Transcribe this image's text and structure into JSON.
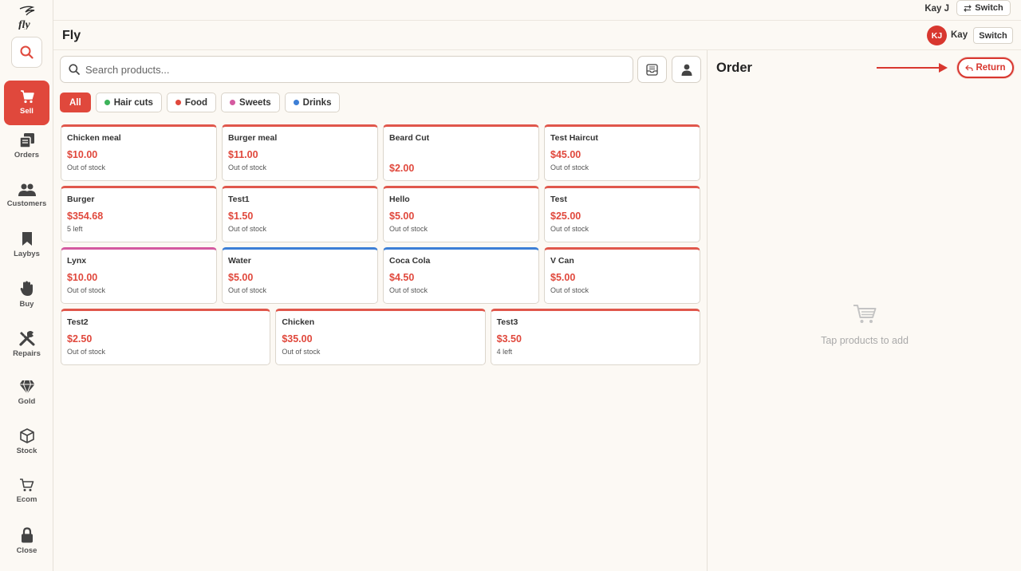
{
  "app": {
    "logo_text": "fly",
    "title": "Fly"
  },
  "topbar": {
    "user": "Kay J",
    "switch_label": "Switch"
  },
  "header": {
    "avatar_initials": "KJ",
    "user": "Kay",
    "switch_label": "Switch"
  },
  "sidebar": {
    "items": [
      {
        "label": "Sell",
        "icon": "cart-icon",
        "active": true
      },
      {
        "label": "Orders",
        "icon": "orders-icon"
      },
      {
        "label": "Customers",
        "icon": "customers-icon"
      },
      {
        "label": "Laybys",
        "icon": "bookmark-icon"
      },
      {
        "label": "Buy",
        "icon": "hand-icon"
      },
      {
        "label": "Repairs",
        "icon": "tools-icon"
      },
      {
        "label": "Gold",
        "icon": "diamond-icon"
      },
      {
        "label": "Stock",
        "icon": "box-icon"
      },
      {
        "label": "Ecom",
        "icon": "ecom-cart-icon"
      },
      {
        "label": "Close",
        "icon": "lock-icon"
      }
    ]
  },
  "search": {
    "placeholder": "Search products..."
  },
  "categories": [
    {
      "label": "All",
      "active": true
    },
    {
      "label": "Hair cuts",
      "color": "#3cb35a"
    },
    {
      "label": "Food",
      "color": "#e0483c"
    },
    {
      "label": "Sweets",
      "color": "#d45aa0"
    },
    {
      "label": "Drinks",
      "color": "#3d7fd6"
    }
  ],
  "products": [
    {
      "name": "Chicken meal",
      "price": "$10.00",
      "stock": "Out of stock",
      "color": "#e0574b"
    },
    {
      "name": "Burger meal",
      "price": "$11.00",
      "stock": "Out of stock",
      "color": "#e0574b"
    },
    {
      "name": "Beard Cut",
      "price": "$2.00",
      "stock": "",
      "color": "#e0574b"
    },
    {
      "name": "Test Haircut",
      "price": "$45.00",
      "stock": "Out of stock",
      "color": "#e0574b"
    },
    {
      "name": "Burger",
      "price": "$354.68",
      "stock": "5 left",
      "color": "#e0574b"
    },
    {
      "name": "Test1",
      "price": "$1.50",
      "stock": "Out of stock",
      "color": "#e0574b"
    },
    {
      "name": "Hello",
      "price": "$5.00",
      "stock": "Out of stock",
      "color": "#e0574b"
    },
    {
      "name": "Test",
      "price": "$25.00",
      "stock": "Out of stock",
      "color": "#e0574b"
    },
    {
      "name": "Lynx",
      "price": "$10.00",
      "stock": "Out of stock",
      "color": "#d45aa0"
    },
    {
      "name": "Water",
      "price": "$5.00",
      "stock": "Out of stock",
      "color": "#3d7fd6"
    },
    {
      "name": "Coca Cola",
      "price": "$4.50",
      "stock": "Out of stock",
      "color": "#3d7fd6"
    },
    {
      "name": "V Can",
      "price": "$5.00",
      "stock": "Out of stock",
      "color": "#e0574b"
    },
    {
      "name": "Test2",
      "price": "$2.50",
      "stock": "Out of stock",
      "color": "#e0574b"
    },
    {
      "name": "Chicken",
      "price": "$35.00",
      "stock": "Out of stock",
      "color": "#e0574b"
    },
    {
      "name": "Test3",
      "price": "$3.50",
      "stock": "4 left",
      "color": "#e0574b"
    }
  ],
  "order": {
    "title": "Order",
    "return_label": "Return",
    "empty_message": "Tap products to add"
  },
  "colors": {
    "accent": "#e0483c",
    "background": "#fcf9f4"
  }
}
